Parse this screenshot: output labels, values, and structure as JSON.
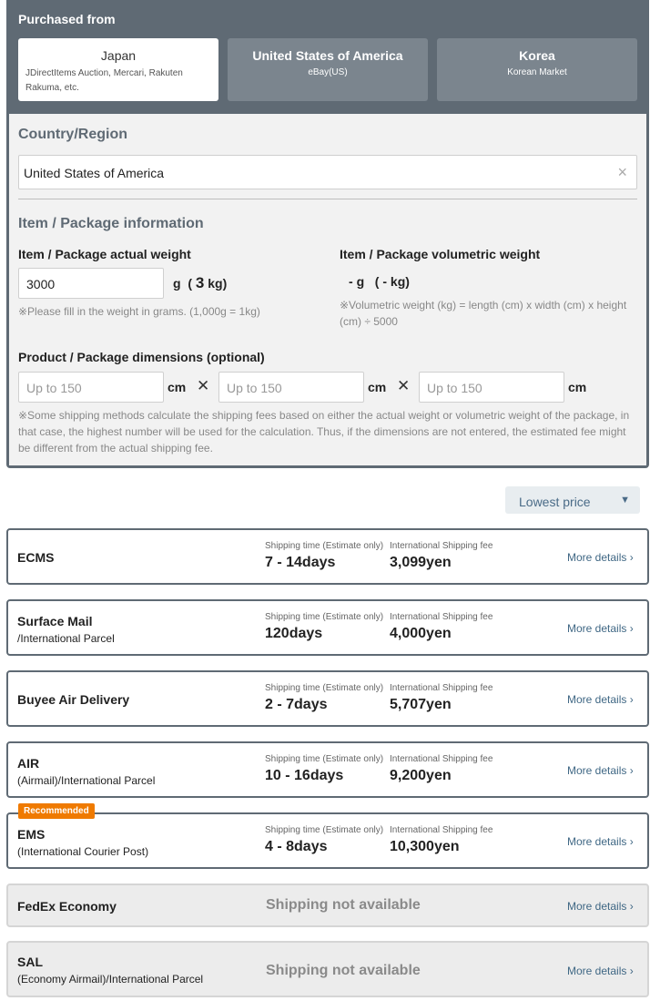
{
  "purchased_from": {
    "title": "Purchased from",
    "tabs": [
      {
        "name": "Japan",
        "sub": "JDirectItems Auction, Mercari, Rakuten Rakuma, etc.",
        "selected": true
      },
      {
        "name": "United States of America",
        "sub": "eBay(US)",
        "selected": false
      },
      {
        "name": "Korea",
        "sub": "Korean Market",
        "selected": false
      }
    ]
  },
  "form": {
    "country_title": "Country/Region",
    "country_value": "United States of America",
    "clear_icon": "×",
    "item_title": "Item / Package information",
    "actual_weight_label": "Item / Package actual weight",
    "actual_weight_value": "3000",
    "actual_weight_unit": "g",
    "actual_weight_kg_open": "(",
    "actual_weight_kg": "3",
    "actual_weight_kg_close": "kg)",
    "actual_weight_hint": "※Please fill in the weight in grams. (1,000g = 1kg)",
    "volumetric_label": "Item / Package volumetric weight",
    "volumetric_value": "-",
    "volumetric_unit": "g",
    "volumetric_kg_open": "(",
    "volumetric_kg": "-",
    "volumetric_kg_close": "kg)",
    "volumetric_hint": "※Volumetric weight (kg) = length (cm) x width (cm) x height (cm) ÷ 5000",
    "dimensions_label": "Product / Package dimensions (optional)",
    "dimension_placeholder": "Up to 150",
    "dimension_unit": "cm",
    "times_symbol": "✕",
    "dimensions_note": "※Some shipping methods calculate the shipping fees based on either the actual weight or volumetric weight of the package, in that case, the highest number will be used for the calculation. Thus, if the dimensions are not entered, the estimated fee might be different from the actual shipping fee."
  },
  "sort": {
    "selected": "Lowest price",
    "caret": "▼"
  },
  "shipping": {
    "time_label": "Shipping time (Estimate only)",
    "fee_label": "International Shipping fee",
    "more_label": "More details ›",
    "na_label": "Shipping not available",
    "recommended_label": "Recommended",
    "methods": [
      {
        "name": "ECMS",
        "sub": "",
        "time": "7 - 14days",
        "fee": "3,099yen"
      },
      {
        "name": "Surface Mail",
        "sub": "/International Parcel",
        "time": "120days",
        "fee": "4,000yen"
      },
      {
        "name": "Buyee Air Delivery",
        "sub": "",
        "time": "2 - 7days",
        "fee": "5,707yen"
      },
      {
        "name": "AIR",
        "sub": "(Airmail)/International Parcel",
        "time": "10 - 16days",
        "fee": "9,200yen"
      },
      {
        "name": "EMS",
        "sub": "(International Courier Post)",
        "time": "4 - 8days",
        "fee": "10,300yen"
      },
      {
        "name": "FedEx Economy",
        "sub": "",
        "time": "",
        "fee": ""
      },
      {
        "name": "SAL",
        "sub": "(Economy Airmail)/International Parcel",
        "time": "",
        "fee": ""
      }
    ]
  }
}
